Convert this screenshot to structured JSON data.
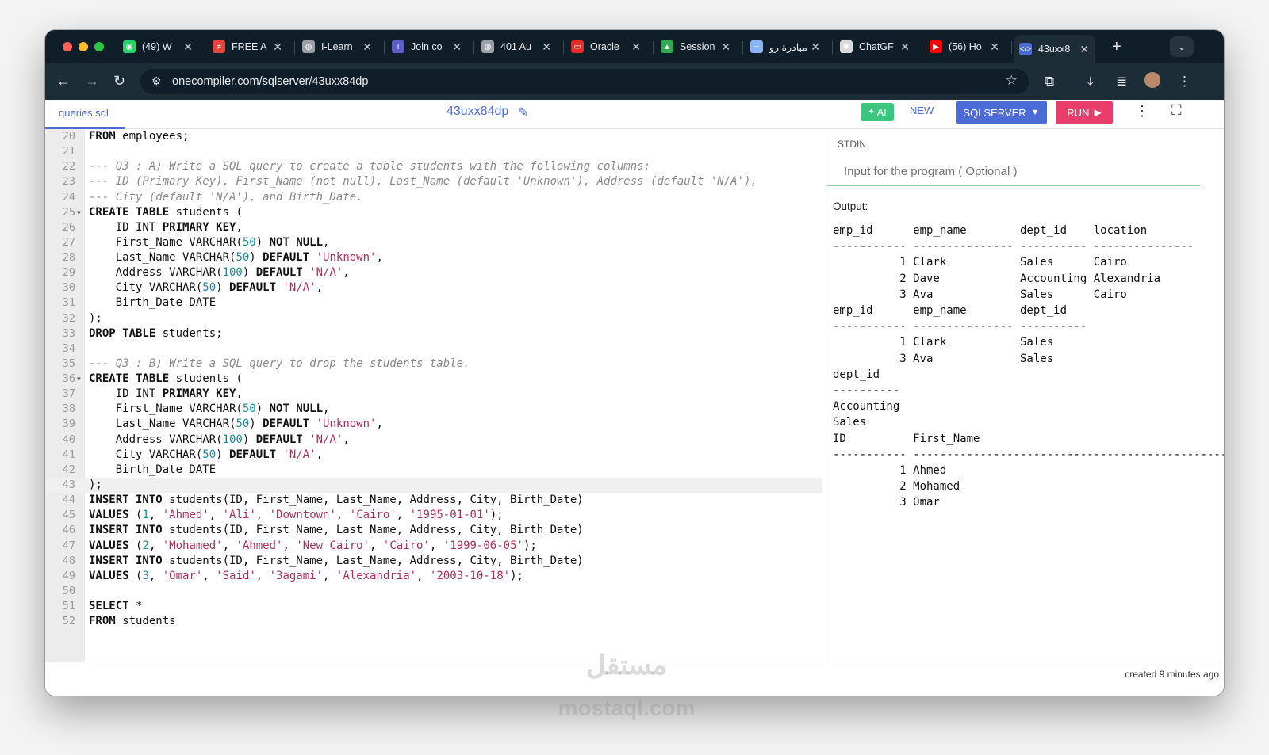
{
  "browser": {
    "tabs": [
      {
        "label": "(49) W",
        "icon": "whatsapp-icon",
        "color": "#25d366",
        "glyph": "◉"
      },
      {
        "label": "FREE A",
        "icon": "freeapp-icon",
        "color": "#e8453c",
        "glyph": "≠"
      },
      {
        "label": "I-Learn",
        "icon": "globe-icon",
        "color": "#9aa0a6",
        "glyph": "◍"
      },
      {
        "label": "Join co",
        "icon": "teams-icon",
        "color": "#5b5fc7",
        "glyph": "T"
      },
      {
        "label": "401 Au",
        "icon": "globe-icon",
        "color": "#9aa0a6",
        "glyph": "◍"
      },
      {
        "label": "Oracle",
        "icon": "oracle-icon",
        "color": "#e52d27",
        "glyph": "▭"
      },
      {
        "label": "Session",
        "icon": "drive-icon",
        "color": "#34a853",
        "glyph": "▲"
      },
      {
        "label": "مبادرة رو",
        "icon": "initiative-icon",
        "color": "#8ab4f8",
        "glyph": "~"
      },
      {
        "label": "ChatGF",
        "icon": "chatgpt-icon",
        "color": "#d8dadc",
        "glyph": "✺"
      },
      {
        "label": "(56) Ho",
        "icon": "youtube-icon",
        "color": "#ff0000",
        "glyph": "▶"
      },
      {
        "label": "43uxx8",
        "icon": "onecompiler-icon",
        "color": "#4b6bd6",
        "glyph": "</>"
      }
    ],
    "url": "onecompiler.com/sqlserver/43uxx84dp"
  },
  "app": {
    "file_tab": "queries.sql",
    "file_name": "43uxx84dp",
    "ai_label": "AI",
    "new_label": "NEW",
    "language_label": "SQLSERVER",
    "run_label": "RUN",
    "stdin_label": "STDIN",
    "stdin_placeholder": "Input for the program ( Optional )",
    "output_label": "Output:",
    "output_text": "emp_id      emp_name        dept_id    location\n----------- --------------- ---------- ---------------\n          1 Clark           Sales      Cairo\n          2 Dave            Accounting Alexandria\n          3 Ava             Sales      Cairo\nemp_id      emp_name        dept_id\n----------- --------------- ----------\n          1 Clark           Sales\n          3 Ava             Sales\ndept_id\n----------\nAccounting\nSales\nID          First_Name\n----------- --------------------------------------------------\n          1 Ahmed\n          2 Mohamed\n          3 Omar",
    "created": "created 9 minutes ago"
  },
  "editor": {
    "lines": [
      {
        "n": "20",
        "t": [
          [
            "kw",
            "FROM"
          ],
          [
            "p",
            " employees;"
          ]
        ]
      },
      {
        "n": "21",
        "t": []
      },
      {
        "n": "22",
        "t": [
          [
            "com",
            "--- Q3 : A) Write a SQL query to create a table students with the following columns:"
          ]
        ]
      },
      {
        "n": "23",
        "t": [
          [
            "com",
            "--- ID (Primary Key), First_Name (not null), Last_Name (default 'Unknown'), Address (default 'N/A'),"
          ]
        ]
      },
      {
        "n": "24",
        "t": [
          [
            "com",
            "--- City (default 'N/A'), and Birth_Date."
          ]
        ]
      },
      {
        "n": "25",
        "fold": true,
        "t": [
          [
            "kw",
            "CREATE TABLE"
          ],
          [
            "p",
            " students ("
          ]
        ]
      },
      {
        "n": "26",
        "t": [
          [
            "p",
            "    ID INT "
          ],
          [
            "kw",
            "PRIMARY KEY"
          ],
          [
            "p",
            ","
          ]
        ]
      },
      {
        "n": "27",
        "t": [
          [
            "p",
            "    First_Name VARCHAR("
          ],
          [
            "num",
            "50"
          ],
          [
            "p",
            ") "
          ],
          [
            "kw",
            "NOT NULL"
          ],
          [
            "p",
            ","
          ]
        ]
      },
      {
        "n": "28",
        "t": [
          [
            "p",
            "    Last_Name VARCHAR("
          ],
          [
            "num",
            "50"
          ],
          [
            "p",
            ") "
          ],
          [
            "kw",
            "DEFAULT"
          ],
          [
            "p",
            " "
          ],
          [
            "str",
            "'Unknown'"
          ],
          [
            "p",
            ","
          ]
        ]
      },
      {
        "n": "29",
        "t": [
          [
            "p",
            "    Address VARCHAR("
          ],
          [
            "num",
            "100"
          ],
          [
            "p",
            ") "
          ],
          [
            "kw",
            "DEFAULT"
          ],
          [
            "p",
            " "
          ],
          [
            "str",
            "'N/A'"
          ],
          [
            "p",
            ","
          ]
        ]
      },
      {
        "n": "30",
        "t": [
          [
            "p",
            "    City VARCHAR("
          ],
          [
            "num",
            "50"
          ],
          [
            "p",
            ") "
          ],
          [
            "kw",
            "DEFAULT"
          ],
          [
            "p",
            " "
          ],
          [
            "str",
            "'N/A'"
          ],
          [
            "p",
            ","
          ]
        ]
      },
      {
        "n": "31",
        "t": [
          [
            "p",
            "    Birth_Date DATE"
          ]
        ]
      },
      {
        "n": "32",
        "t": [
          [
            "p",
            ");"
          ]
        ]
      },
      {
        "n": "33",
        "t": [
          [
            "kw",
            "DROP TABLE"
          ],
          [
            "p",
            " students;"
          ]
        ]
      },
      {
        "n": "34",
        "t": []
      },
      {
        "n": "35",
        "t": [
          [
            "com",
            "--- Q3 : B) Write a SQL query to drop the students table."
          ]
        ]
      },
      {
        "n": "36",
        "fold": true,
        "t": [
          [
            "kw",
            "CREATE TABLE"
          ],
          [
            "p",
            " students ("
          ]
        ]
      },
      {
        "n": "37",
        "t": [
          [
            "p",
            "    ID INT "
          ],
          [
            "kw",
            "PRIMARY KEY"
          ],
          [
            "p",
            ","
          ]
        ]
      },
      {
        "n": "38",
        "t": [
          [
            "p",
            "    First_Name VARCHAR("
          ],
          [
            "num",
            "50"
          ],
          [
            "p",
            ") "
          ],
          [
            "kw",
            "NOT NULL"
          ],
          [
            "p",
            ","
          ]
        ]
      },
      {
        "n": "39",
        "t": [
          [
            "p",
            "    Last_Name VARCHAR("
          ],
          [
            "num",
            "50"
          ],
          [
            "p",
            ") "
          ],
          [
            "kw",
            "DEFAULT"
          ],
          [
            "p",
            " "
          ],
          [
            "str",
            "'Unknown'"
          ],
          [
            "p",
            ","
          ]
        ]
      },
      {
        "n": "40",
        "t": [
          [
            "p",
            "    Address VARCHAR("
          ],
          [
            "num",
            "100"
          ],
          [
            "p",
            ") "
          ],
          [
            "kw",
            "DEFAULT"
          ],
          [
            "p",
            " "
          ],
          [
            "str",
            "'N/A'"
          ],
          [
            "p",
            ","
          ]
        ]
      },
      {
        "n": "41",
        "t": [
          [
            "p",
            "    City VARCHAR("
          ],
          [
            "num",
            "50"
          ],
          [
            "p",
            ") "
          ],
          [
            "kw",
            "DEFAULT"
          ],
          [
            "p",
            " "
          ],
          [
            "str",
            "'N/A'"
          ],
          [
            "p",
            ","
          ]
        ]
      },
      {
        "n": "42",
        "t": [
          [
            "p",
            "    Birth_Date DATE"
          ]
        ]
      },
      {
        "n": "43",
        "hl": true,
        "t": [
          [
            "p",
            ");"
          ]
        ]
      },
      {
        "n": "44",
        "t": [
          [
            "kw",
            "INSERT INTO"
          ],
          [
            "p",
            " students(ID, First_Name, Last_Name, Address, City, Birth_Date)"
          ]
        ]
      },
      {
        "n": "45",
        "t": [
          [
            "kw",
            "VALUES"
          ],
          [
            "p",
            " ("
          ],
          [
            "num",
            "1"
          ],
          [
            "p",
            ", "
          ],
          [
            "str",
            "'Ahmed'"
          ],
          [
            "p",
            ", "
          ],
          [
            "str",
            "'Ali'"
          ],
          [
            "p",
            ", "
          ],
          [
            "str",
            "'Downtown'"
          ],
          [
            "p",
            ", "
          ],
          [
            "str",
            "'Cairo'"
          ],
          [
            "p",
            ", "
          ],
          [
            "str",
            "'1995-01-01'"
          ],
          [
            "p",
            ");"
          ]
        ]
      },
      {
        "n": "46",
        "t": [
          [
            "kw",
            "INSERT INTO"
          ],
          [
            "p",
            " students(ID, First_Name, Last_Name, Address, City, Birth_Date)"
          ]
        ]
      },
      {
        "n": "47",
        "t": [
          [
            "kw",
            "VALUES"
          ],
          [
            "p",
            " ("
          ],
          [
            "num",
            "2"
          ],
          [
            "p",
            ", "
          ],
          [
            "str",
            "'Mohamed'"
          ],
          [
            "p",
            ", "
          ],
          [
            "str",
            "'Ahmed'"
          ],
          [
            "p",
            ", "
          ],
          [
            "str",
            "'New Cairo'"
          ],
          [
            "p",
            ", "
          ],
          [
            "str",
            "'Cairo'"
          ],
          [
            "p",
            ", "
          ],
          [
            "str",
            "'1999-06-05'"
          ],
          [
            "p",
            ");"
          ]
        ]
      },
      {
        "n": "48",
        "t": [
          [
            "kw",
            "INSERT INTO"
          ],
          [
            "p",
            " students(ID, First_Name, Last_Name, Address, City, Birth_Date)"
          ]
        ]
      },
      {
        "n": "49",
        "t": [
          [
            "kw",
            "VALUES"
          ],
          [
            "p",
            " ("
          ],
          [
            "num",
            "3"
          ],
          [
            "p",
            ", "
          ],
          [
            "str",
            "'Omar'"
          ],
          [
            "p",
            ", "
          ],
          [
            "str",
            "'Said'"
          ],
          [
            "p",
            ", "
          ],
          [
            "str",
            "'3agami'"
          ],
          [
            "p",
            ", "
          ],
          [
            "str",
            "'Alexandria'"
          ],
          [
            "p",
            ", "
          ],
          [
            "str",
            "'2003-10-18'"
          ],
          [
            "p",
            ");"
          ]
        ]
      },
      {
        "n": "50",
        "t": []
      },
      {
        "n": "51",
        "t": [
          [
            "kw",
            "SELECT"
          ],
          [
            "p",
            " *"
          ]
        ]
      },
      {
        "n": "52",
        "t": [
          [
            "kw",
            "FROM"
          ],
          [
            "p",
            " students"
          ]
        ]
      }
    ]
  },
  "watermark": {
    "arabic": "مستقل",
    "latin": "mostaql.com"
  }
}
